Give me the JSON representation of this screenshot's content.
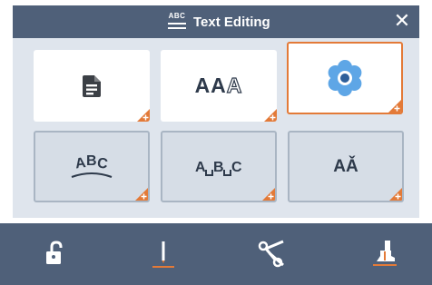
{
  "dialog": {
    "title": "Text Editing",
    "title_icon_text": "ABC",
    "close_glyph": "✕"
  },
  "tiles": [
    {
      "name": "document",
      "icon": "document-icon",
      "has_plus_badge": true,
      "style": "white"
    },
    {
      "name": "font-style",
      "icon": "font-style-aaa-icon",
      "label": "AAA",
      "has_plus_badge": true,
      "style": "white"
    },
    {
      "name": "settings",
      "icon": "flower-gear-icon",
      "has_plus_badge": true,
      "style": "white",
      "selected": true
    },
    {
      "name": "arc-text",
      "icon": "arc-text-icon",
      "label": "ABC",
      "has_plus_badge": true,
      "style": "grey"
    },
    {
      "name": "letter-spacing",
      "icon": "letter-spacing-icon",
      "label": "A_B_C",
      "has_plus_badge": true,
      "style": "grey"
    },
    {
      "name": "accent-letters",
      "icon": "accent-letters-icon",
      "label": "AǍ",
      "has_plus_badge": true,
      "style": "grey"
    }
  ],
  "toolbar": {
    "buttons": [
      {
        "name": "unlock",
        "icon": "unlock-icon"
      },
      {
        "name": "needle",
        "icon": "needle-icon"
      },
      {
        "name": "scissors",
        "icon": "scissors-icon"
      },
      {
        "name": "presser-foot",
        "icon": "presser-foot-icon"
      }
    ]
  },
  "colors": {
    "header": "#4f6079",
    "panel": "#dfe5ed",
    "accent": "#e37a38",
    "icon_dark": "#2e3a4b",
    "flower_blue": "#5ea6e6"
  }
}
